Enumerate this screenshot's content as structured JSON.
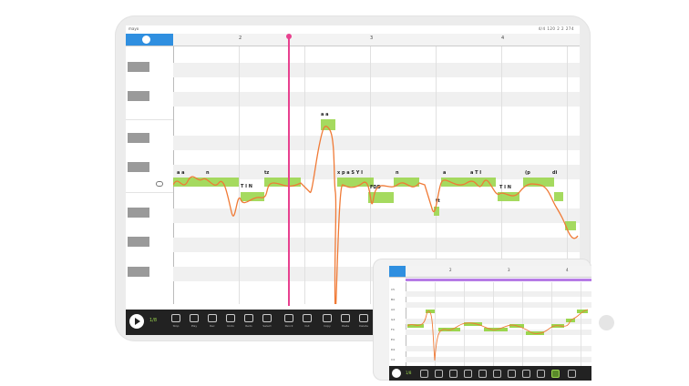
{
  "tablet": {
    "track_name": "mayo",
    "transport_readout": "4/4 120   2 2 274",
    "ruler_numbers": [
      "2",
      "3",
      "4"
    ],
    "lyrics": [
      "a a",
      "n",
      "T I N",
      "tz",
      "a a",
      "x p a S Y I",
      "FDD",
      "n",
      "tt",
      "a",
      "a T I",
      "T I N",
      "(p",
      "di"
    ],
    "tempo": "1/8",
    "toolbar": [
      {
        "label": "Stop",
        "icon": "stop-icon"
      },
      {
        "label": "Play",
        "icon": "play-icon"
      },
      {
        "label": "Rec",
        "icon": "record-icon"
      },
      {
        "label": "Undo",
        "icon": "undo-icon"
      },
      {
        "label": "Redo",
        "icon": "redo-icon"
      },
      {
        "label": "Select",
        "icon": "select-icon"
      },
      {
        "label": "Pencil",
        "icon": "pencil-icon"
      },
      {
        "label": "Cut",
        "icon": "scissors-icon"
      },
      {
        "label": "Copy",
        "icon": "copy-icon"
      },
      {
        "label": "Paste",
        "icon": "paste-icon"
      },
      {
        "label": "Delete",
        "icon": "trash-icon"
      },
      {
        "label": "Loop",
        "icon": "loop-icon"
      },
      {
        "label": "Vibrato",
        "icon": "vibrato-icon"
      },
      {
        "label": "Pitch",
        "icon": "pitch-icon"
      }
    ],
    "colors": {
      "accent": "#9bd64e",
      "playhead": "#e8418f",
      "pitch": "#f07a36",
      "header": "#2f8fe0"
    }
  },
  "phone": {
    "ruler_numbers": [
      "2",
      "3",
      "4"
    ],
    "tempo": "1/8",
    "key_labels": [
      "C5",
      "B4",
      "A4",
      "G4",
      "F4",
      "E4",
      "D4",
      "C4"
    ],
    "toolbar_icons": [
      "play-icon",
      "stop-icon",
      "undo-icon",
      "redo-icon",
      "select-icon",
      "pencil-icon",
      "copy-icon",
      "paste-icon",
      "loop-icon",
      "vibrato-icon",
      "pitch-icon",
      "settings-icon"
    ],
    "colors": {
      "lane": "#b67be6"
    }
  }
}
